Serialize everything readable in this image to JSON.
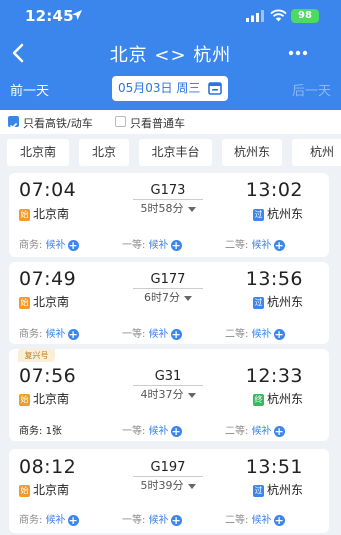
{
  "status_bar": {
    "time": "12:45",
    "battery": "98"
  },
  "nav": {
    "title": "北京 <> 杭州"
  },
  "date_bar": {
    "prev": "前一天",
    "date": "05月03日 周三",
    "next": "后一天"
  },
  "filters": [
    {
      "label": "只看高铁/动车",
      "checked": true
    },
    {
      "label": "只看普通车",
      "checked": false
    }
  ],
  "stations": [
    "北京南",
    "北京",
    "北京丰台",
    "杭州东",
    "杭州"
  ],
  "trains": [
    {
      "dep_time": "07:04",
      "from": "北京南",
      "from_badge": "始",
      "number": "G173",
      "duration": "5时58分",
      "arr_time": "13:02",
      "to": "杭州东",
      "to_badge": "过",
      "seats": [
        {
          "class": "商务: ",
          "value": "候补"
        },
        {
          "class": "一等: ",
          "value": "候补"
        },
        {
          "class": "二等: ",
          "value": "候补"
        }
      ]
    },
    {
      "dep_time": "07:49",
      "from": "北京南",
      "from_badge": "始",
      "number": "G177",
      "duration": "6时7分",
      "arr_time": "13:56",
      "to": "杭州东",
      "to_badge": "过",
      "seats": [
        {
          "class": "商务: ",
          "value": "候补"
        },
        {
          "class": "一等: ",
          "value": "候补"
        },
        {
          "class": "二等: ",
          "value": "候补"
        }
      ]
    },
    {
      "tag": "复兴号",
      "dep_time": "07:56",
      "from": "北京南",
      "from_badge": "始",
      "number": "G31",
      "duration": "4时37分",
      "arr_time": "12:33",
      "to": "杭州东",
      "to_badge": "终",
      "seats": [
        {
          "class": "商务: ",
          "value": "1张"
        },
        {
          "class": "一等: ",
          "value": "候补"
        },
        {
          "class": "二等: ",
          "value": "候补"
        }
      ]
    },
    {
      "dep_time": "08:12",
      "from": "北京南",
      "from_badge": "始",
      "number": "G197",
      "duration": "5时39分",
      "arr_time": "13:51",
      "to": "杭州东",
      "to_badge": "过",
      "seats": [
        {
          "class": "商务: ",
          "value": "候补"
        },
        {
          "class": "一等: ",
          "value": "候补"
        },
        {
          "class": "二等: ",
          "value": "候补"
        }
      ]
    }
  ],
  "colors": {
    "primary": "#3a86ed",
    "start_badge": "#f39a2c",
    "end_badge": "#3ab75f",
    "tag_bg": "#fbeed7"
  }
}
